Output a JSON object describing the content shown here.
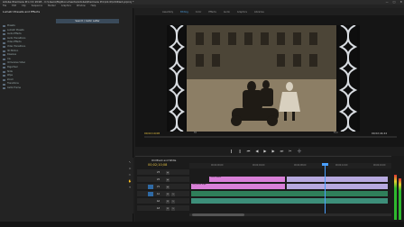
{
  "window": {
    "title": "Adobe Premiere Pro CC 2018 - C:\\Users\\ftq\\Documents\\Adobe\\Premiere Pro\\12.0\\Untitled.prproj *",
    "controls": [
      "—",
      "□",
      "✕"
    ]
  },
  "menu": [
    "File",
    "Edit",
    "Clip",
    "Sequence",
    "Marker",
    "Graphics",
    "Window",
    "Help"
  ],
  "workspaces": {
    "items": [
      "Assembly",
      "Editing",
      "Color",
      "Effects",
      "Audio",
      "Graphics",
      "Libraries"
    ],
    "active_index": 1
  },
  "effects_panel": {
    "title": "Lumetri Presets and Effects",
    "header": "Search / Celtic Letter",
    "items": [
      "Presets",
      "Lumetri Presets",
      "Audio Effects",
      "Audio Transitions",
      "Video Effects",
      "Video Transitions",
      "3D Motion",
      "Dissolve",
      "Iris",
      "Immersive Video",
      "Page Peel",
      "Slide",
      "Wipe",
      "Zoom",
      "Transitions",
      "Celtic Frame"
    ]
  },
  "program_monitor": {
    "timecode_left": "00;02;10;08",
    "fit": "Fit",
    "quality": "Full",
    "timecode_right": "00;02;44;24"
  },
  "transport": [
    "❙",
    "❙",
    "⏮",
    "◀",
    "▶",
    "▶",
    "⏭",
    "✂",
    "➕"
  ],
  "timeline": {
    "sequence_name": "Old Black and White",
    "timecode": "00;02;10;08",
    "ruler": [
      "00;02;00;00",
      "00;02;04;00",
      "00;02;08;00",
      "00;02;12;00",
      "00;02;16;00"
    ],
    "tracks": [
      {
        "name": "V3",
        "kind": "video"
      },
      {
        "name": "V2",
        "kind": "video"
      },
      {
        "name": "V1",
        "kind": "video"
      },
      {
        "name": "A1",
        "kind": "audio"
      },
      {
        "name": "A2",
        "kind": "audio"
      },
      {
        "name": "A3",
        "kind": "audio"
      }
    ],
    "clips": [
      {
        "label": "Celtic frame",
        "track": "V2",
        "color": "#d980d8"
      },
      {
        "label": "Old_scene.mp4",
        "track": "V1",
        "color": "#b7a9df"
      },
      {
        "label": "",
        "track": "A1",
        "color": "#2f7f5a"
      },
      {
        "label": "",
        "track": "A2",
        "color": "#3d8f7a"
      }
    ],
    "track_buttons": [
      "M",
      "S"
    ]
  },
  "tools": [
    "↖",
    "⇔",
    "✂",
    "✋",
    "T"
  ],
  "colors": {
    "timecode": "#e8c341",
    "playhead": "#4aa0ff",
    "accent": "#4a9de0"
  }
}
